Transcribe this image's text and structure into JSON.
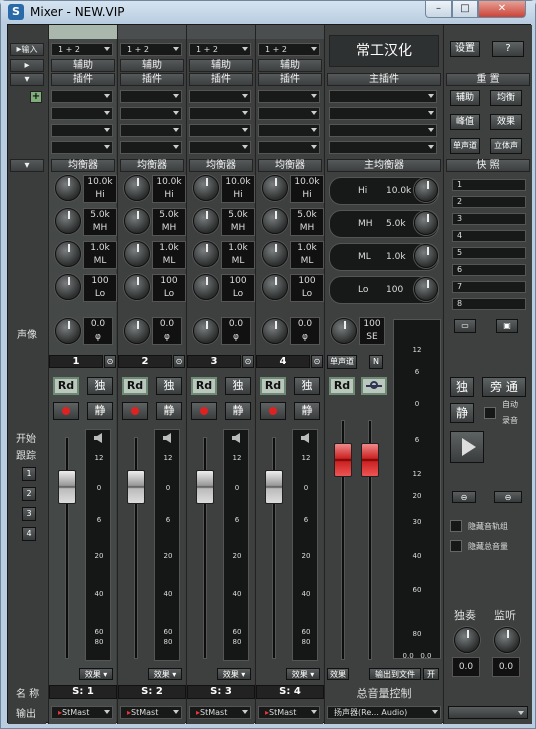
{
  "window": {
    "title": "Mixer - NEW.VIP",
    "icon_letter": "S",
    "min": "–",
    "max": "□",
    "close": "✕"
  },
  "top": {
    "input_label": "输入",
    "aux_label": "辅助",
    "plugin_label": "插件",
    "eq_label": "均衡器",
    "bus_title": "常工汉化",
    "main_plugin": "主插件",
    "main_eq": "主均衡器",
    "settings": "设置",
    "help": "?",
    "reset": "重 置",
    "snapshot": "快 照"
  },
  "channels": [
    {
      "input": "1 + 2",
      "num": "1",
      "name": "S: 1",
      "output": "StMast",
      "eq": [
        "10.0k",
        "5.0k",
        "1.0k",
        "100"
      ],
      "eqb": [
        "Hi",
        "MH",
        "ML",
        "Lo"
      ],
      "pan": "0.0"
    },
    {
      "input": "1 + 2",
      "num": "2",
      "name": "S: 2",
      "output": "StMast",
      "eq": [
        "10.0k",
        "5.0k",
        "1.0k",
        "100"
      ],
      "eqb": [
        "Hi",
        "MH",
        "ML",
        "Lo"
      ],
      "pan": "0.0"
    },
    {
      "input": "1 + 2",
      "num": "3",
      "name": "S: 3",
      "output": "StMast",
      "eq": [
        "10.0k",
        "5.0k",
        "1.0k",
        "100"
      ],
      "eqb": [
        "Hi",
        "MH",
        "ML",
        "Lo"
      ],
      "pan": "0.0"
    },
    {
      "input": "1 + 2",
      "num": "4",
      "name": "S: 4",
      "output": "StMast",
      "eq": [
        "10.0k",
        "5.0k",
        "1.0k",
        "100"
      ],
      "eqb": [
        "Hi",
        "MH",
        "ML",
        "Lo"
      ],
      "pan": "0.0"
    }
  ],
  "master": {
    "eq": [
      {
        "b": "Hi",
        "v": "10.0k"
      },
      {
        "b": "MH",
        "v": "5.0k"
      },
      {
        "b": "ML",
        "v": "1.0k"
      },
      {
        "b": "Lo",
        "v": "100"
      }
    ],
    "pan": "100",
    "pan2": "SE",
    "mono": "单声道",
    "n": "N",
    "name": "总音量控制",
    "output_btn": "输出到文件",
    "open": "开",
    "out": "扬声器(Re... Audio)"
  },
  "labels": {
    "pan": "声像",
    "follow1": "开始",
    "follow2": "跟踪",
    "name": "名 称",
    "output": "输出",
    "rd": "Rd",
    "solo": "独",
    "mute": "静",
    "effects": "效果"
  },
  "right": {
    "btns": [
      [
        "辅助",
        "均衡"
      ],
      [
        "峰值",
        "效果"
      ],
      [
        "单声道",
        "立体声"
      ]
    ],
    "snaps": [
      "1",
      "2",
      "3",
      "4",
      "5",
      "6",
      "7",
      "8"
    ],
    "solo": "独",
    "bypass": "旁 通",
    "mute": "静",
    "autorec1": "自动",
    "autorec2": "录音",
    "hide_tracks": "隐藏音轨组",
    "hide_master": "隐藏总音量",
    "solo_l": "独奏",
    "monitor": "监听",
    "knob1": "0.0",
    "knob2": "0.0",
    "knob3": "0.0",
    "knob4": "0.0"
  },
  "follow": [
    "1",
    "2",
    "3",
    "4"
  ],
  "scale": [
    "12",
    "0",
    "6",
    "20",
    "40",
    "60",
    "80"
  ],
  "mscale": [
    "12",
    "6",
    "0",
    "6",
    "12",
    "20",
    "30",
    "40",
    "60",
    "80"
  ]
}
